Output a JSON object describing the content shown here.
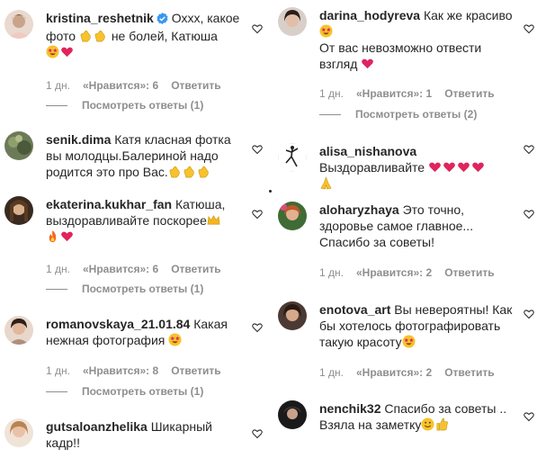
{
  "labels": {
    "likes_prefix": "«Нравится»:",
    "reply": "Ответить",
    "show_replies": "Посмотреть ответы"
  },
  "colors": {
    "heart": "#e0245e",
    "verified": "#3897f0",
    "meta": "#8e8e8e"
  },
  "left": [
    {
      "username": "kristina_reshetnik",
      "verified": true,
      "lines": [
        "Оххх, какое",
        "фото",
        "не болей, Катюша",
        ""
      ],
      "emoji_line1": [
        "clap-emoji",
        "clap-emoji"
      ],
      "emoji_line2": [
        "star-eyes-emoji",
        "heart-emoji"
      ],
      "time": "1 дн.",
      "likes": "6",
      "replies": "(1)"
    },
    {
      "username": "senik.dima",
      "lines": [
        "Катя класная фотка",
        "вы молодцы.Балериной надо",
        "родится это про Вас."
      ],
      "emoji_line": [
        "clap-emoji",
        "clap-emoji",
        "clap-emoji"
      ]
    },
    {
      "username": "ekaterina.kukhar_fan",
      "lines": [
        "Катюша,",
        "выздоравливайте поскорее"
      ],
      "emoji_line1": [
        "crown-emoji"
      ],
      "emoji_line2": [
        "fire-emoji",
        "heart-emoji"
      ],
      "time": "1 дн.",
      "likes": "6",
      "replies": "(1)"
    },
    {
      "username": "romanovskaya_21.01.84",
      "lines": [
        "Какая",
        "нежная фотография"
      ],
      "emoji_line": [
        "star-eyes-emoji"
      ],
      "time": "1 дн.",
      "likes": "8",
      "replies": "(1)"
    },
    {
      "username": "gutsaloanzhelika",
      "lines": [
        "Шикарный",
        "кадр!!"
      ]
    }
  ],
  "right": [
    {
      "username": "darina_hodyreva",
      "lines": [
        "Как же красиво",
        "От вас невозможно отвести",
        "взгляд"
      ],
      "emoji_line1": [
        "star-eyes-emoji"
      ],
      "emoji_line2": [
        "heart-emoji"
      ],
      "time": "1 дн.",
      "likes": "1",
      "replies": "(2)"
    },
    {
      "username": "alisa_nishanova",
      "lines": [
        "Выздоравливайте"
      ],
      "emoji_line1": [
        "heart-emoji",
        "heart-emoji",
        "heart-emoji",
        "heart-emoji"
      ],
      "emoji_line2": [
        "pray-emoji"
      ]
    },
    {
      "username": "aloharyzhaya",
      "lines": [
        "Это точно,",
        "здоровье самое главное...",
        "Спасибо за советы!"
      ],
      "time": "1 дн.",
      "likes": "2"
    },
    {
      "username": "enotova_art",
      "lines": [
        "Вы невероятны! Как",
        "бы хотелось фотографировать",
        "такую красоту"
      ],
      "emoji_line": [
        "star-eyes-emoji"
      ],
      "time": "1 дн.",
      "likes": "2"
    },
    {
      "username": "nenchik32",
      "lines": [
        "Спасибо за советы ..",
        "Взяла на заметку"
      ],
      "emoji_line": [
        "smile-emoji",
        "thumbs-up-emoji"
      ]
    }
  ]
}
